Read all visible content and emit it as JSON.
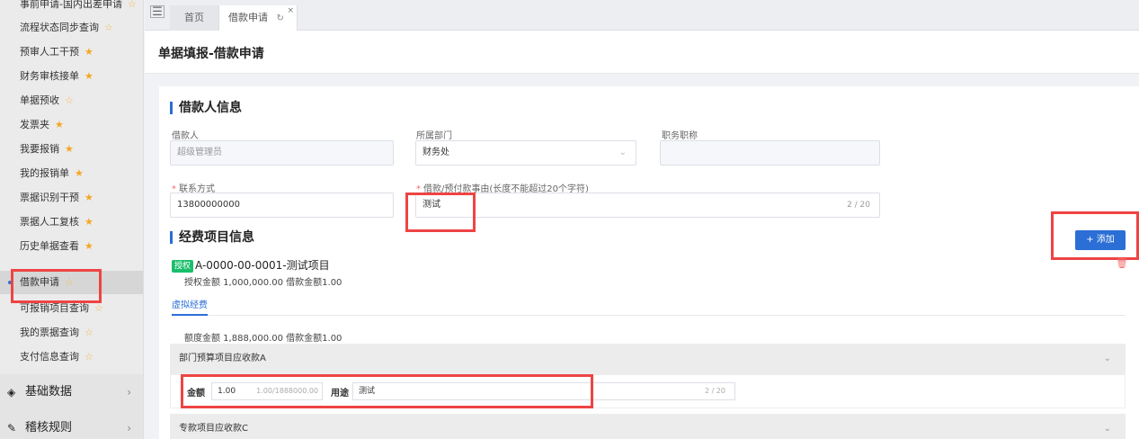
{
  "sidebar": {
    "items": [
      {
        "label": "事前申请-国内出差申请",
        "star": "hollow"
      },
      {
        "label": "流程状态同步查询",
        "star": "hollow"
      },
      {
        "label": "预审人工干预",
        "star": "filled"
      },
      {
        "label": "财务审核接单",
        "star": "filled"
      },
      {
        "label": "单据预收",
        "star": "hollow"
      },
      {
        "label": "发票夹",
        "star": "filled"
      },
      {
        "label": "我要报销",
        "star": "filled"
      },
      {
        "label": "我的报销单",
        "star": "filled"
      },
      {
        "label": "票据识别干预",
        "star": "filled"
      },
      {
        "label": "票据人工复核",
        "star": "filled"
      },
      {
        "label": "历史单据查看",
        "star": "filled"
      },
      {
        "label": "借款申请",
        "star": "hollow"
      },
      {
        "label": "可报销项目查询",
        "star": "hollow"
      },
      {
        "label": "我的票据查询",
        "star": "hollow"
      },
      {
        "label": "支付信息查询",
        "star": "hollow"
      }
    ],
    "groups": [
      {
        "label": "基础数据",
        "icon": "cube-icon"
      },
      {
        "label": "稽核规则",
        "icon": "edit-icon"
      }
    ]
  },
  "tabs": {
    "home": "首页",
    "active": "借款申请"
  },
  "page": {
    "title": "单据填报-借款申请"
  },
  "borrower": {
    "section_title": "借款人信息",
    "name_label": "借款人",
    "name_value": "超级管理员",
    "dept_label": "所属部门",
    "dept_value": "财务处",
    "position_label": "职务职称",
    "position_value": "",
    "contact_label": "联系方式",
    "contact_value": "13800000000",
    "reason_label": "借款/预付款事由(长度不能超过20个字符)",
    "reason_value": "测试",
    "reason_count": "2 / 20"
  },
  "expense": {
    "section_title": "经费项目信息",
    "add_button": "+ 添加",
    "auth_tag": "授权",
    "project_title": "A-0000-00-0001-测试项目",
    "project_amount": "授权金额 1,000,000.00 借款金额1.00",
    "subtab": "虚拟经费",
    "quota": "额度金额 1,888,000.00 借款金额1.00",
    "panel_a": "部门预算项目应收款A",
    "panel_c": "专款项目应收款C",
    "amount_label": "金额",
    "amount_value": "1.00",
    "amount_hint": "1.00/1888000.00",
    "purpose_label": "用途",
    "purpose_value": "测试",
    "purpose_count": "2 / 20"
  },
  "colors": {
    "accent": "#2b6ed6",
    "highlight": "#ee4444",
    "star": "#f5a623",
    "auth_tag": "#19be6b"
  }
}
